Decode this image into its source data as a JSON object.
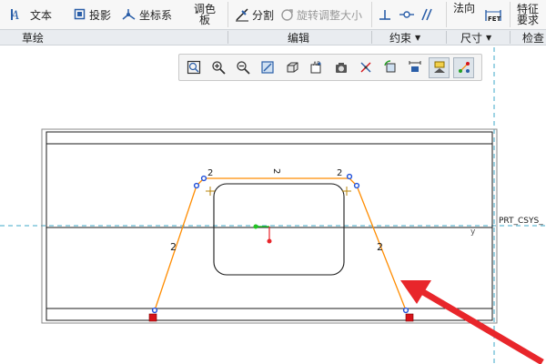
{
  "ribbon": {
    "text_label": "文本",
    "project_label": "投影",
    "coordsys_label": "坐标系",
    "palette_line1": "调色",
    "palette_line2": "板",
    "divide_label": "分割",
    "rotate_resize_label": "旋转调整大小",
    "normal_label": "法向",
    "feature_req_line1": "特征",
    "feature_req_line2": "要求"
  },
  "groups": {
    "sketch": "草绘",
    "edit": "编辑",
    "constrain": "约束",
    "dimension": "尺寸",
    "inspect": "检查"
  },
  "canvas": {
    "csys_label": "PRT_CSYS_",
    "constraint_glyph": "2",
    "colors": {
      "sketch": "#ff8c00",
      "geometry": "#1a1a1a",
      "axis": "#3fa9c9",
      "arrow": "#e8262b",
      "vertex": "#1f4fd9",
      "end_marker": "#d6141b",
      "origin": "#22c322"
    }
  },
  "graphics_toolbar": {
    "icons": [
      "refit-icon",
      "zoom-in-icon",
      "zoom-out-icon",
      "repaint-icon",
      "display-style-icon",
      "saved-views-icon",
      "view-manager-icon",
      "datum-display-icon",
      "spin-center-icon",
      "annotation-display-icon",
      "sketch-view-icon",
      "sketch-display-icon"
    ]
  }
}
